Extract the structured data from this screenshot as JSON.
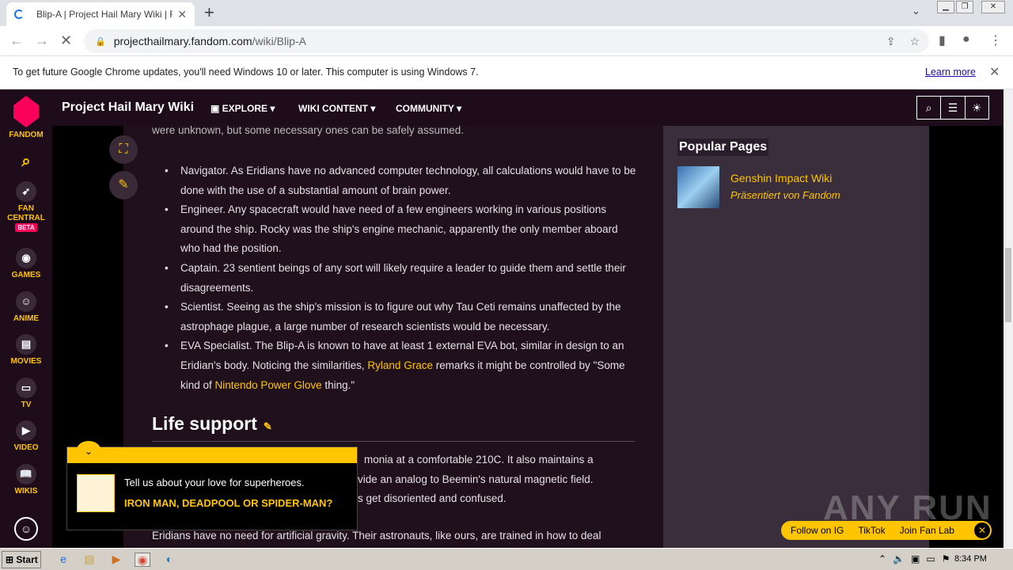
{
  "browser": {
    "tab_title": "Blip-A | Project Hail Mary Wiki | Fand",
    "url_host": "projecthailmary.fandom.com",
    "url_path": "/wiki/Blip-A",
    "new_tab": "+",
    "tab_close": "✕"
  },
  "infobar": {
    "message": "To get future Google Chrome updates, you'll need Windows 10 or later. This computer is using Windows 7.",
    "learn_more": "Learn more"
  },
  "rail": {
    "fandom": "FANDOM",
    "fan_central": "FAN CENTRAL",
    "beta": "BETA",
    "games": "GAMES",
    "anime": "ANIME",
    "movies": "MOVIES",
    "tv": "TV",
    "video": "VIDEO",
    "wikis": "WIKIS"
  },
  "header": {
    "wiki_name": "Project Hail Mary Wiki",
    "explore": "EXPLORE",
    "wiki_content": "WIKI CONTENT",
    "community": "COMMUNITY"
  },
  "article": {
    "top_text": "were unknown, but some necessary ones can be safely assumed.",
    "bullets": [
      "Navigator. As Eridians have no advanced computer technology, all calculations would have to be done with the use of a substantial amount of brain power.",
      "Engineer. Any spacecraft would have need of a few engineers working in various positions around the ship. Rocky was the ship's engine mechanic, apparently the only member aboard who had the position.",
      "Captain. 23 sentient beings of any sort will likely require a leader to guide them and settle their disagreements.",
      "Scientist. Seeing as the ship's mission is to figure out why Tau Ceti remains unaffected by the astrophage plague, a large number of research scientists would be necessary."
    ],
    "eva_a": "EVA Specialist. The Blip-A is known to have at least 1 external EVA bot, similar in design to an Eridian's body. Noticing the similarities, ",
    "eva_link1": "Ryland Grace",
    "eva_b": " remarks it might be controlled by \"Some kind of ",
    "eva_link2": "Nintendo Power Glove",
    "eva_c": " thing.\"",
    "section_title": "Life support",
    "ls_line1": "monia at a comfortable 210C. It also maintains a",
    "ls_line2": "vide an analog to Beemin's natural magnetic field.",
    "ls_line3": "s get disoriented and confused.",
    "bottom_line": "Eridians have no need for artificial gravity. Their astronauts, like ours, are trained in how to deal"
  },
  "right_rail": {
    "heading": "Popular Pages",
    "item_title": "Genshin Impact Wiki",
    "item_sub": "Präsentiert von Fandom"
  },
  "popup": {
    "question": "Tell us about your love for superheroes.",
    "answer": "IRON MAN, DEADPOOL OR SPIDER-MAN?"
  },
  "social": {
    "ig": "Follow on IG",
    "tiktok": "TikTok",
    "fanlab": "Join Fan Lab"
  },
  "watermark": "ANY RUN",
  "taskbar": {
    "start": "Start",
    "time": "8:34 PM"
  }
}
